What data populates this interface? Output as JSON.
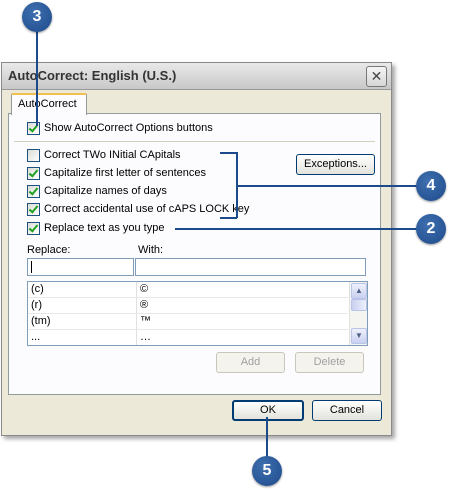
{
  "dialog": {
    "title": "AutoCorrect: English (U.S.)",
    "close_glyph": "✕",
    "tab_label": "AutoCorrect",
    "show_options": {
      "label": "Show AutoCorrect Options buttons",
      "checked": true
    },
    "options": [
      {
        "label": "Correct TWo INitial CApitals",
        "checked": false
      },
      {
        "label": "Capitalize first letter of sentences",
        "checked": true
      },
      {
        "label": "Capitalize names of days",
        "checked": true
      },
      {
        "label": "Correct accidental use of cAPS LOCK key",
        "checked": true
      }
    ],
    "exceptions_label": "Exceptions...",
    "replace_as_you_type": {
      "label": "Replace text as you type",
      "checked": true
    },
    "replace_label": "Replace:",
    "with_label": "With:",
    "replace_value": "",
    "with_value": "",
    "entries": [
      {
        "replace": "(c)",
        "with": "©"
      },
      {
        "replace": "(r)",
        "with": "®"
      },
      {
        "replace": "(tm)",
        "with": "™"
      },
      {
        "replace": "...",
        "with": "…"
      }
    ],
    "add_label": "Add",
    "delete_label": "Delete",
    "ok_label": "OK",
    "cancel_label": "Cancel"
  },
  "callouts": {
    "c3": "3",
    "c4": "4",
    "c2": "2",
    "c5": "5"
  },
  "colors": {
    "callout": "#1d4a8a",
    "dialog_bg": "#ece9d8"
  }
}
